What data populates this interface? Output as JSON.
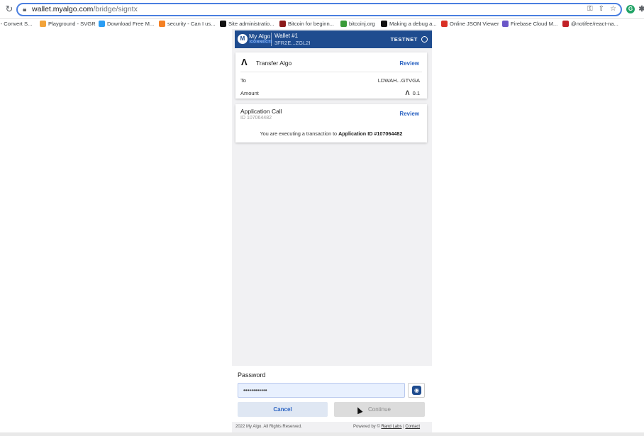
{
  "browser": {
    "url_host": "wallet.myalgo.com",
    "url_path": "/bridge/signtx",
    "bookmarks": [
      {
        "label": "r - Convert S...",
        "icon": "convert-icon",
        "color": "#888888"
      },
      {
        "label": "Playground - SVGR",
        "icon": "svgr-icon",
        "color": "#f2a33a"
      },
      {
        "label": "Download Free M...",
        "icon": "play-icon",
        "color": "#2a9df4"
      },
      {
        "label": "security - Can I us...",
        "icon": "stackexchange-icon",
        "color": "#f48024"
      },
      {
        "label": "Site administratio...",
        "icon": "algorand-icon",
        "color": "#111111"
      },
      {
        "label": "Bitcoin for beginn...",
        "icon": "book-icon",
        "color": "#8b1a1a"
      },
      {
        "label": "bitcoinj.org",
        "icon": "bitcoinj-icon",
        "color": "#3a9b3a"
      },
      {
        "label": "Making a debug a...",
        "icon": "medium-icon",
        "color": "#111111"
      },
      {
        "label": "Online JSON Viewer",
        "icon": "json-icon",
        "color": "#d93025"
      },
      {
        "label": "Firebase Cloud M...",
        "icon": "firebase-icon",
        "color": "#6b57c8"
      },
      {
        "label": "@notifee/react-na...",
        "icon": "npm-icon",
        "color": "#c12127"
      }
    ]
  },
  "header": {
    "logo_text": "My Algo",
    "logo_sub": "CONNECT",
    "wallet_name": "Wallet #1",
    "wallet_address": "3FR2E...ZGL2I",
    "network": "TESTNET"
  },
  "transfer_card": {
    "title": "Transfer Algo",
    "review": "Review",
    "to_label": "To",
    "to_value": "LDWAH...GTVGA",
    "amount_label": "Amount",
    "amount_value": "0.1"
  },
  "app_card": {
    "title": "Application Call",
    "id_text": "ID 107064482",
    "review": "Review",
    "message_prefix": "You are executing a transaction to",
    "message_bold": "Application ID #107064482"
  },
  "form": {
    "password_label": "Password",
    "password_value": "••••••••••••",
    "cancel_label": "Cancel",
    "continue_label": "Continue"
  },
  "footer": {
    "copyright": "2022 My Algo. All Rights Reserved.",
    "powered_prefix": "Powered by ©",
    "powered_link": "Rand Labs",
    "separator": "|",
    "contact": "Contact"
  },
  "colors": {
    "brand": "#1f4c8f",
    "accent": "#2b63c2"
  }
}
